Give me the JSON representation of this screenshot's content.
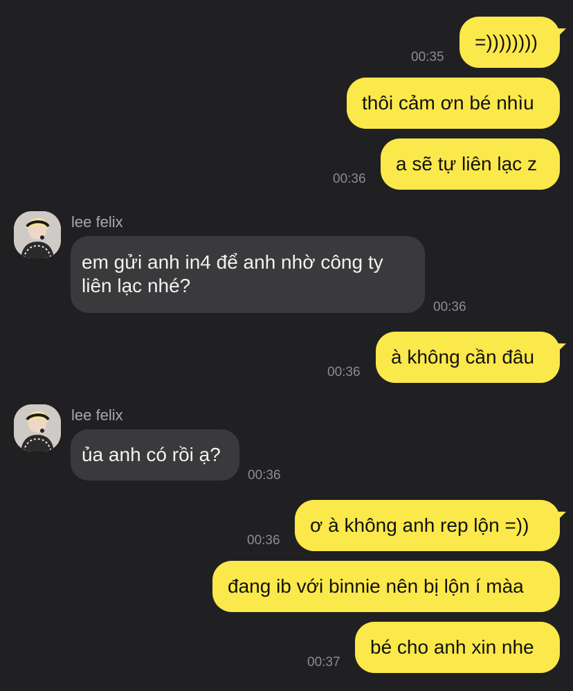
{
  "contact": {
    "name": "lee felix"
  },
  "messages": [
    {
      "side": "sent",
      "text": "=))))))))",
      "time": "00:35"
    },
    {
      "side": "sent",
      "text": "thôi cảm ơn bé nhìu",
      "time": ""
    },
    {
      "side": "sent",
      "text": "a sẽ tự liên lạc z",
      "time": "00:36"
    },
    {
      "side": "received",
      "sender": "lee felix",
      "line1": "em gửi anh in4 để anh nhờ công ty",
      "line2": "liên lạc nhé?",
      "time": "00:36"
    },
    {
      "side": "sent",
      "text": "à không cần đâu",
      "time": "00:36"
    },
    {
      "side": "received",
      "sender": "lee felix",
      "text": "ủa anh có rồi ạ?",
      "time": "00:36"
    },
    {
      "side": "sent",
      "text": "ơ à không anh rep lộn =))",
      "time": "00:36"
    },
    {
      "side": "sent",
      "text": "đang ib với binnie nên bị lộn í màa",
      "time": ""
    },
    {
      "side": "sent",
      "text": "bé cho anh xin nhe",
      "time": "00:37"
    }
  ],
  "colors": {
    "background": "#202022",
    "sent_bubble": "#fbe84a",
    "received_bubble": "#3a3a3c",
    "timestamp": "#8d8d90"
  },
  "icons": {
    "avatar": "profile-photo"
  }
}
